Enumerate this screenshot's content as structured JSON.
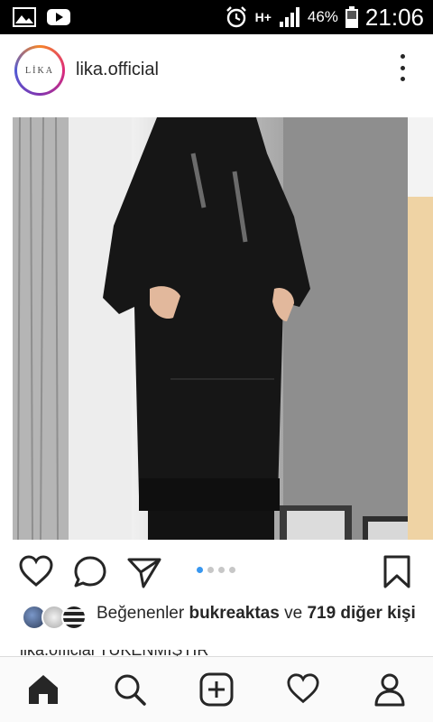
{
  "status_bar": {
    "network_type": "H+",
    "battery_percent": "46%",
    "time": "21:06",
    "left_icons": [
      "gallery-notification-icon",
      "youtube-notification-icon"
    ],
    "right_icons": [
      "alarm-icon",
      "signal-icon",
      "battery-icon"
    ]
  },
  "post": {
    "account_logo_text": "LİKA",
    "username": "lika.official",
    "carousel": {
      "total": 4,
      "active_index": 0
    },
    "likes": {
      "prefix": "Beğenenler ",
      "user": "bukreaktas",
      "middle": " ve ",
      "count_text": "719 diğer kişi"
    },
    "caption_peek": "lika.official TÜKENMİŞTİR"
  },
  "actions": {
    "icons": [
      "heart-icon",
      "comment-icon",
      "share-icon",
      "bookmark-icon"
    ]
  },
  "bottom_nav": {
    "items": [
      "home-icon",
      "search-icon",
      "new-post-icon",
      "activity-icon",
      "profile-icon"
    ],
    "active": "home-icon"
  },
  "colors": {
    "accent": "#3897f0",
    "text": "#262626"
  }
}
